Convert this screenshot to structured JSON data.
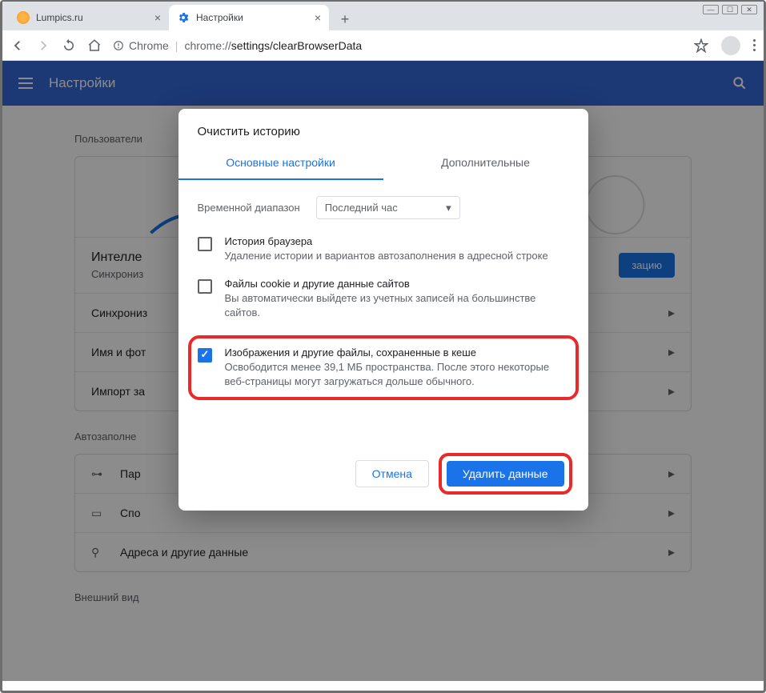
{
  "window": {
    "tabs": [
      {
        "title": "Lumpics.ru",
        "favicon": "orange"
      },
      {
        "title": "Настройки",
        "favicon": "gear"
      }
    ]
  },
  "toolbar": {
    "security_label": "Chrome",
    "url_domain": "chrome://",
    "url_path": "settings/clearBrowserData"
  },
  "settings_header": {
    "title": "Настройки"
  },
  "sections": {
    "users_label": "Пользователи",
    "intel": {
      "title": "Интелле",
      "sub": "Синхрониз",
      "button": "зацию"
    },
    "rows": [
      {
        "label": "Синхрониз"
      },
      {
        "label": "Имя и фот"
      },
      {
        "label": "Импорт за"
      }
    ],
    "autofill_label": "Автозаполне",
    "autofill_rows": [
      {
        "icon": "key",
        "label": "Пар"
      },
      {
        "icon": "card",
        "label": "Спо"
      },
      {
        "icon": "pin",
        "label": "Адреса и другие данные"
      }
    ],
    "appearance_label": "Внешний вид"
  },
  "dialog": {
    "title": "Очистить историю",
    "tabs": {
      "basic": "Основные настройки",
      "advanced": "Дополнительные"
    },
    "time_range_label": "Временной диапазон",
    "time_range_value": "Последний час",
    "items": [
      {
        "checked": false,
        "title": "История браузера",
        "sub": "Удаление истории и вариантов автозаполнения в адресной строке"
      },
      {
        "checked": false,
        "title": "Файлы cookie и другие данные сайтов",
        "sub": "Вы автоматически выйдете из учетных записей на большинстве сайтов."
      },
      {
        "checked": true,
        "title": "Изображения и другие файлы, сохраненные в кеше",
        "sub": "Освободится менее 39,1 МБ пространства. После этого некоторые веб-страницы могут загружаться дольше обычного."
      }
    ],
    "cancel": "Отмена",
    "confirm": "Удалить данные"
  }
}
